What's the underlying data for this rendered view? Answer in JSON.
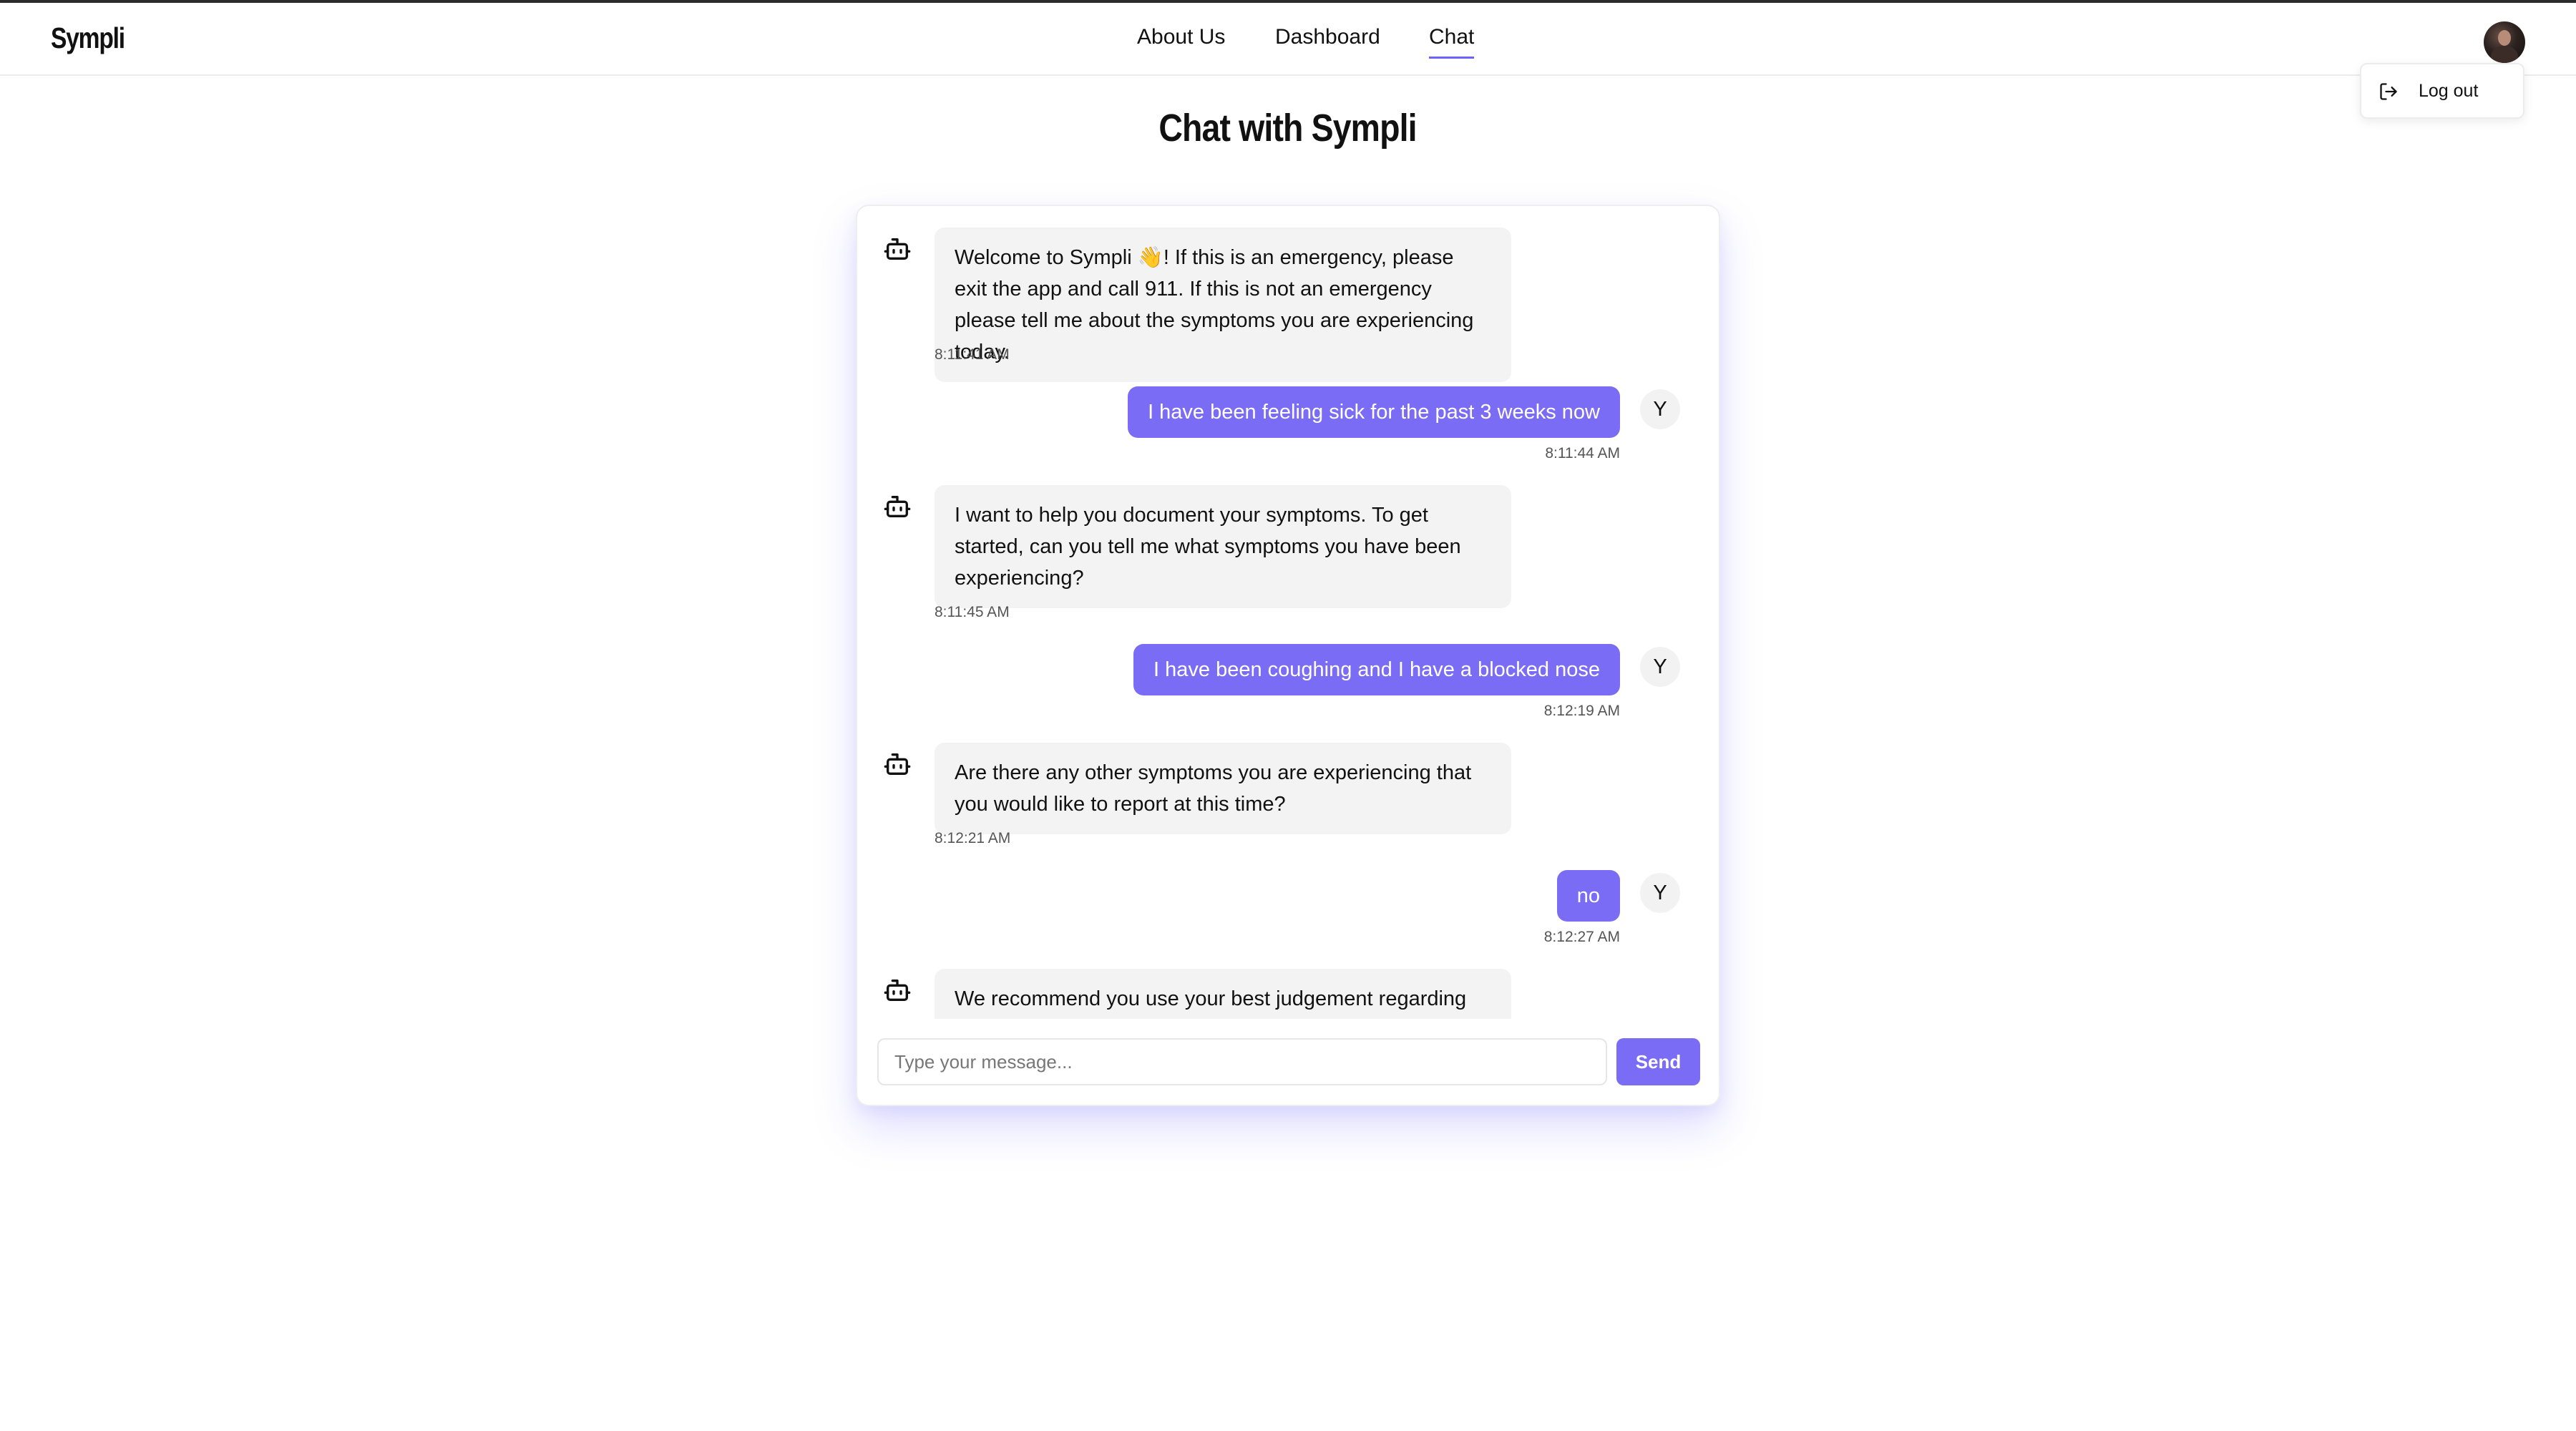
{
  "app": {
    "logo": "Sympli"
  },
  "nav": {
    "items": [
      {
        "label": "About Us"
      },
      {
        "label": "Dashboard"
      },
      {
        "label": "Chat",
        "active": true
      }
    ]
  },
  "user_menu": {
    "avatar_icon": "user-avatar-photo",
    "logout_label": "Log out",
    "logout_icon": "logout-icon"
  },
  "page": {
    "title": "Chat with Sympli"
  },
  "chat": {
    "messages": [
      {
        "sender": "bot",
        "text": "Welcome to Sympli 👋! If this is an emergency, please exit the app and call 911. If this is not an emergency please tell me about the symptoms you are experiencing today.",
        "time": "8:11:41 AM"
      },
      {
        "sender": "user",
        "avatar": "Y",
        "text": "I have been feeling sick for the past 3 weeks now",
        "time": "8:11:44 AM"
      },
      {
        "sender": "bot",
        "text": "I want to help you document your symptoms. To get started, can you tell me what symptoms you have been experiencing?",
        "time": "8:11:45 AM"
      },
      {
        "sender": "user",
        "avatar": "Y",
        "text": "I have been coughing and I have a blocked nose",
        "time": "8:12:19 AM"
      },
      {
        "sender": "bot",
        "text": "Are there any other symptoms you are experiencing that you would like to report at this time?",
        "time": "8:12:21 AM"
      },
      {
        "sender": "user",
        "avatar": "Y",
        "text": "no",
        "time": "8:12:27 AM"
      },
      {
        "sender": "bot",
        "text": "We recommend you use your best judgement regarding"
      }
    ],
    "input_placeholder": "Type your message...",
    "input_value": "",
    "send_label": "Send"
  },
  "colors": {
    "accent": "#7b6cf6",
    "bot_bubble": "#f3f3f3",
    "nav_underline": "#6c63ff"
  }
}
